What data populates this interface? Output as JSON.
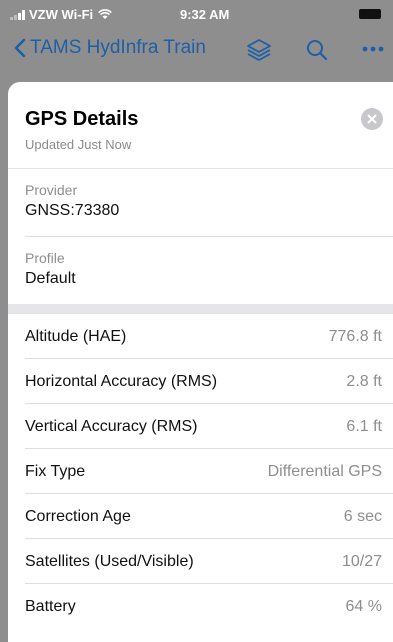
{
  "status": {
    "carrier": "VZW Wi-Fi",
    "time": "9:32 AM"
  },
  "nav": {
    "title": "TAMS HydInfra Train",
    "icons": [
      "chevron-left-icon",
      "layers-icon",
      "search-icon",
      "more-icon"
    ]
  },
  "sheet": {
    "title": "GPS Details",
    "subtitle": "Updated Just Now",
    "provider_label": "Provider",
    "provider_value": "GNSS:73380",
    "profile_label": "Profile",
    "profile_value": "Default",
    "rows": [
      {
        "key": "Altitude (HAE)",
        "value": "776.8 ft"
      },
      {
        "key": "Horizontal Accuracy (RMS)",
        "value": "2.8 ft"
      },
      {
        "key": "Vertical Accuracy (RMS)",
        "value": "6.1 ft"
      },
      {
        "key": "Fix Type",
        "value": "Differential GPS"
      },
      {
        "key": "Correction Age",
        "value": "6 sec"
      },
      {
        "key": "Satellites (Used/Visible)",
        "value": "10/27"
      },
      {
        "key": "Battery",
        "value": "64 %"
      }
    ]
  },
  "colors": {
    "accent": "#1f5fa8",
    "overlay": "#8e8e8e"
  }
}
